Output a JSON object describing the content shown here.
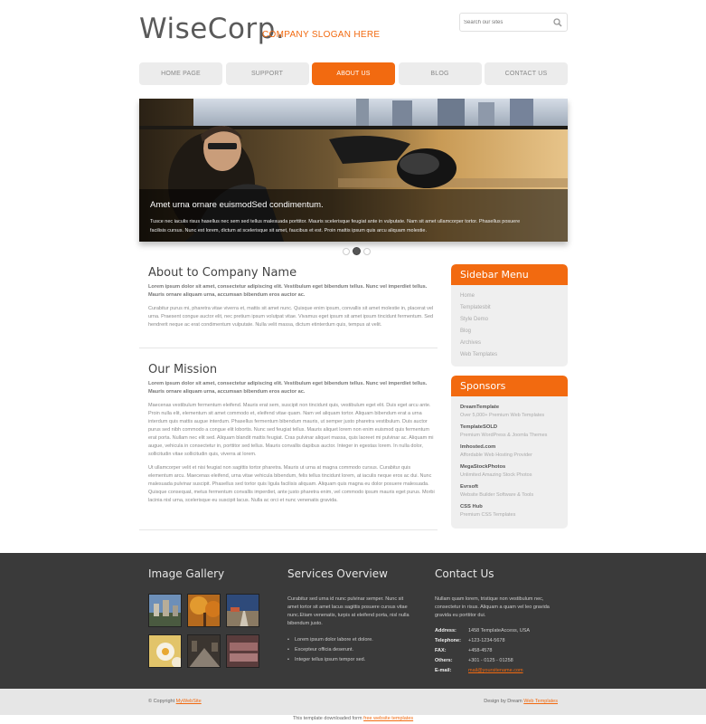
{
  "header": {
    "logo": "WiseCorp.",
    "slogan": "COMPANY SLOGAN HERE",
    "search_placeholder": "Search our sites"
  },
  "nav": {
    "items": [
      "HOME PAGE",
      "SUPPORT",
      "ABOUT US",
      "BLOG",
      "CONTACT US"
    ],
    "active_index": 2
  },
  "banner": {
    "caption_title": "Amet urna ornare euismodSed condimentum.",
    "caption_text": "Tusce nec iaculis risus hasellus nec sem sed tellus malesuada porttitor. Mauris scelerisque feugiat ante in vulputate. Nam sit amet ullamcorper tortor. Phasellus posuere facilisis cursus. Nunc est lorem, dictum at scelerisque sit amet, faucibus et est. Proin mattis ipsum quis arcu aliquam molestie.",
    "slides": 3,
    "active_slide": 2
  },
  "about": {
    "title": "About to Company Name",
    "lead": "Lorem ipsum dolor sit amet, consectetur adipiscing elit. Vestibulum eget bibendum tellus. Nunc vel imperdiet tellus. Mauris ornare aliquam urna, accumsan bibendum eros auctor ac.",
    "text": "Curabitur purus mi, pharetra vitae viverra et, mattis sit amet nunc. Quisque enim ipsum, convallis sit amet molestie in, placerat vel urna. Praesent congue auctor elit, nec pretium ipsum volutpat vitae. Vivamus eget ipsum sit amet ipsum tincidunt fermentum. Sed hendrerit neque ac erat condimentum vulputate. Nulla velit massa, dictum etinterdum quis, tempus at velit."
  },
  "mission": {
    "title": "Our Mission",
    "lead": "Lorem ipsum dolor sit amet, consectetur adipiscing elit. Vestibulum eget bibendum tellus. Nunc vel imperdiet tellus. Mauris ornare aliquam urna, accumsan bibendum eros auctor ac.",
    "text1": "Maecenas vestibulum fermentum eleifend. Mauris erat sem, suscipit non tincidunt quis, vestibulum eget elit. Duis eget arcu ante. Proin nulla elit, elementum sit amet commodo et, eleifend vitae quam. Nam vel aliquam tortor. Aliquam bibendum erat a urna interdum quis mattis augue interdum. Phasellus fermentum bibendum mauris, ut semper justo pharetra vestibulum. Duis auctor purus sed nibh commodo a congue elit lobortis. Nunc sed feugiat tellus. Mauris aliquet lorem non enim euismod quis fermentum erat porta. Nullam nec elit sed. Aliquam blandit mattis feugiat. Cras pulvinar aliquet massa, quis laoreet mi pulvinar ac. Aliquam mi augue, vehicula in consectetur in, porttitor sed tellus. Mauris convallis dapibus auctor. Integer in egestas lorem. In nulla dolor, sollicitudin vitae sollicitudin quis, viverra at lorem.",
    "text2": "Ut ullamcorper velit et nisi feugiat non sagittis tortor pharetra. Mauris ut urna at magna commodo cursus. Curabitur quis elementum arcu. Maecenas eleifend, urna vitae vehicula bibendum, felis tellus tincidunt lorem, at iaculis neque eros ac dui. Nunc malesuada pulvinar suscipit. Phasellus sed tortor quis ligula facilisis aliquam. Aliquam quis magna eu dolor posuere malesuada. Quisque consequat, metus fermentum convallis imperdiet, ante justo pharetra enim, vel commodo ipsum mauris eget purus. Morbi lacinia nisl urna, scelerisque eu suscipit lacus. Nulla ac orci et nunc venenatis gravida."
  },
  "sidebar_menu": {
    "title": "Sidebar Menu",
    "items": [
      "Home",
      "Templatesbit",
      "Style Demo",
      "Blog",
      "Archives",
      "Web Templates"
    ]
  },
  "sponsors": {
    "title": "Sponsors",
    "items": [
      {
        "name": "DreamTemplate",
        "desc": "Over 5,000+ Premium Web Templates"
      },
      {
        "name": "TemplateSOLD",
        "desc": "Premium WordPress & Joomla Themes"
      },
      {
        "name": "Imhosted.com",
        "desc": "Affordable Web Hosting Provider"
      },
      {
        "name": "MegaStockPhotos",
        "desc": "Unlimited Amazing Stock Photos"
      },
      {
        "name": "Evrsoft",
        "desc": "Website Builder Software & Tools"
      },
      {
        "name": "CSS Hub",
        "desc": "Premium CSS Templates"
      }
    ]
  },
  "footer": {
    "gallery_title": "Image Gallery",
    "services_title": "Services Overview",
    "services_text": "Curabitur sed urna id nunc pulvinar semper. Nunc sit amet tortor sit amet lacus sagittis posuere cursus vitae nunc.Etiam venenatis, turpis at eleifend porta, nisl nulla bibendum justo.",
    "services_list": [
      "Lorem ipsum dolor labore et dolore.",
      "Excepteur officia deserunt.",
      "Integer tellus ipsum tempor sed."
    ],
    "contact_title": "Contact Us",
    "contact_text": "Nullam quam lorem, tristique non vestibulum nec, consectetur in risus. Aliquam a quam vel leo gravida gravida eu porttitor dui.",
    "contact_rows": [
      {
        "k": "Address:",
        "v": "1458 TemplateAccess, USA"
      },
      {
        "k": "Telephone:",
        "v": "+123-1234-5678"
      },
      {
        "k": "FAX:",
        "v": "+458-4578"
      },
      {
        "k": "Others:",
        "v": "+301 - 0125 - 01258"
      }
    ],
    "email_label": "E-mail:",
    "email": "mail@yoursitename.com"
  },
  "bottom": {
    "copyright_prefix": "© Copyright",
    "copyright_link": "MyWebSite",
    "design_prefix": "Design by Dream",
    "design_link": "Web Templates",
    "download_prefix": "This template  downloaded form",
    "download_link": "free website templates"
  },
  "colors": {
    "accent": "#f26a10",
    "footer_bg": "#3a3a3a",
    "sidebar_bg": "#efefef",
    "nav_bg": "#ececec"
  }
}
